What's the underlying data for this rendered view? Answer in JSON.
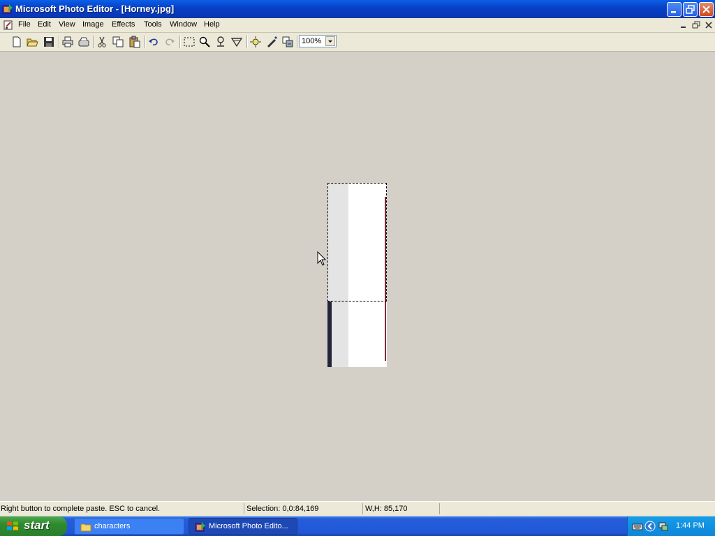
{
  "window": {
    "title": "Microsoft Photo Editor - [Horney.jpg]"
  },
  "menu": {
    "items": [
      "File",
      "Edit",
      "View",
      "Image",
      "Effects",
      "Tools",
      "Window",
      "Help"
    ]
  },
  "toolbar": {
    "tools": [
      "new-file-icon",
      "open-folder-icon",
      "save-icon",
      "print-icon",
      "scan-icon",
      "cut-icon",
      "copy-icon",
      "paste-icon",
      "undo-icon",
      "redo-icon",
      "select-icon",
      "zoom-icon",
      "smudge-icon",
      "sharpen-icon",
      "set-transparent-color-icon",
      "pen-icon",
      "image-properties-icon"
    ],
    "zoom": "100%"
  },
  "image": {
    "selection": true
  },
  "status": {
    "message": "Right button to complete paste. ESC to cancel.",
    "selection": "Selection: 0,0:84,169",
    "size": "W,H: 85,170"
  },
  "taskbar": {
    "start": "start",
    "tasks": [
      {
        "label": "characters",
        "icon": "folder-icon",
        "active": false
      },
      {
        "label": "Microsoft Photo Edito...",
        "icon": "photo-editor-icon",
        "active": true
      }
    ],
    "clock": "1:44 PM"
  },
  "colors": {
    "titlebar": "#0842c8",
    "workspace": "#d4d0c8",
    "taskbar": "#245ddb",
    "start": "#2f8a2f"
  }
}
